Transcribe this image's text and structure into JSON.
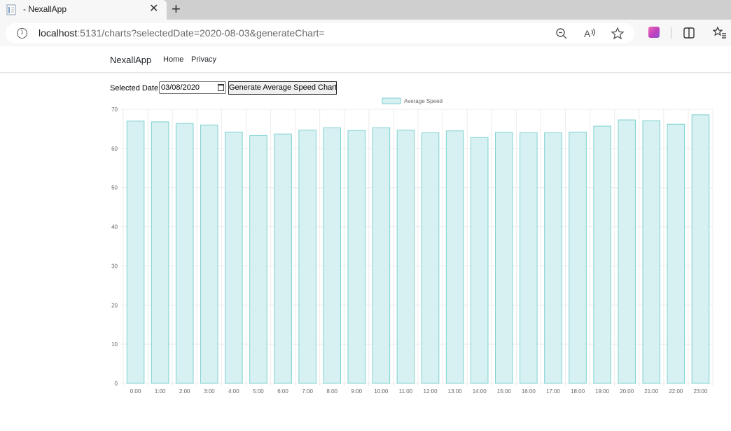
{
  "browser": {
    "tab_title": " - NexallApp",
    "tab_close": "✕",
    "new_tab": "+",
    "url_host": "localhost",
    "url_rest": ":5131/charts?selectedDate=2020-08-03&generateChart="
  },
  "navbar": {
    "brand": "NexallApp",
    "links": [
      "Home",
      "Privacy"
    ]
  },
  "form": {
    "date_label": "Selected Date:",
    "date_value": "03/08/2020",
    "generate_button": "Generate Average Speed Chart"
  },
  "colors": {
    "bar_fill": "#d7f0f1",
    "bar_stroke": "#7fd2d1",
    "grid": "#ececec",
    "legend_fill": "#d7f0f1"
  },
  "chart_data": {
    "type": "bar",
    "legend": "Average Speed",
    "legend_position": "top",
    "grid": true,
    "categories": [
      "0:00",
      "1:00",
      "2:00",
      "3:00",
      "4:00",
      "5:00",
      "6:00",
      "7:00",
      "8:00",
      "9:00",
      "10:00",
      "11:00",
      "12:00",
      "13:00",
      "14:00",
      "15:00",
      "16:00",
      "17:00",
      "18:00",
      "19:00",
      "20:00",
      "21:00",
      "22:00",
      "23:00"
    ],
    "series": [
      {
        "name": "Average Speed",
        "values": [
          67.0,
          66.8,
          66.4,
          66.0,
          64.2,
          63.3,
          63.7,
          64.7,
          65.3,
          64.6,
          65.3,
          64.7,
          64.0,
          64.5,
          62.8,
          64.1,
          64.0,
          64.0,
          64.2,
          65.7,
          67.3,
          67.1,
          66.2,
          68.6
        ]
      }
    ],
    "ylim": [
      0,
      70
    ],
    "yticks": [
      0,
      10,
      20,
      30,
      40,
      50,
      60,
      70
    ]
  }
}
